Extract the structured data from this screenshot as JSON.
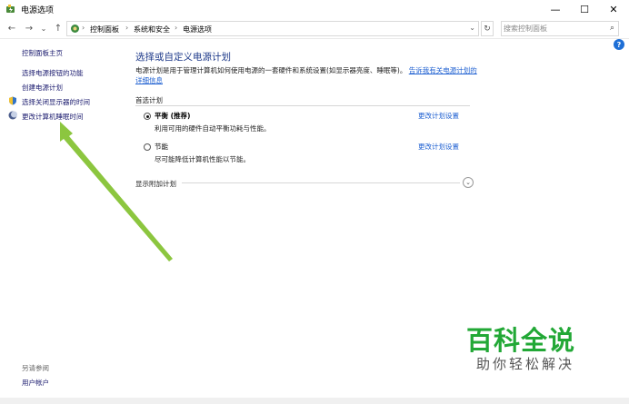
{
  "window": {
    "title": "电源选项",
    "minimize_glyph": "—",
    "maximize_glyph": "☐",
    "close_glyph": "✕"
  },
  "address_bar": {
    "back_glyph": "←",
    "forward_glyph": "→",
    "recent_glyph": "⌄",
    "up_glyph": "↑",
    "breadcrumbs": [
      "控制面板",
      "系统和安全",
      "电源选项"
    ],
    "separator": "›",
    "dropdown_glyph": "⌄",
    "refresh_glyph": "↻"
  },
  "search": {
    "placeholder": "搜索控制面板",
    "icon": "search-icon",
    "icon_glyph": "⌕"
  },
  "sidebar": {
    "home": "控制面板主页",
    "items": [
      {
        "label": "选择电源按钮的功能",
        "icon": null
      },
      {
        "label": "创建电源计划",
        "icon": null
      },
      {
        "label": "选择关闭显示器的时间",
        "icon": "monitor-shield-icon"
      },
      {
        "label": "更改计算机睡眠时间",
        "icon": "moon-icon"
      }
    ],
    "see_also": "另请参阅",
    "see_also_items": [
      "用户帐户"
    ]
  },
  "main": {
    "title": "选择或自定义电源计划",
    "description": "电源计划是用于管理计算机如何使用电源的一套硬件和系统设置(如显示器亮度、睡眠等)。",
    "description_link": "告诉我有关电源计划的详细信息",
    "preferred_label": "首选计划",
    "plans": [
      {
        "name": "平衡 (推荐)",
        "description": "利用可用的硬件自动平衡功耗与性能。",
        "link": "更改计划设置",
        "selected": true
      },
      {
        "name": "节能",
        "description": "尽可能降低计算机性能以节能。",
        "link": "更改计划设置",
        "selected": false
      }
    ],
    "more_plans_label": "显示附加计划",
    "expander_glyph": "⌄"
  },
  "help_glyph": "?",
  "watermark": {
    "logo": "百科全说",
    "subtitle": "助你轻松解决"
  },
  "colors": {
    "link": "#1d5fd1",
    "title": "#1e3a8a",
    "arrow": "#8cc63f",
    "watermark_green": "#22a836"
  }
}
